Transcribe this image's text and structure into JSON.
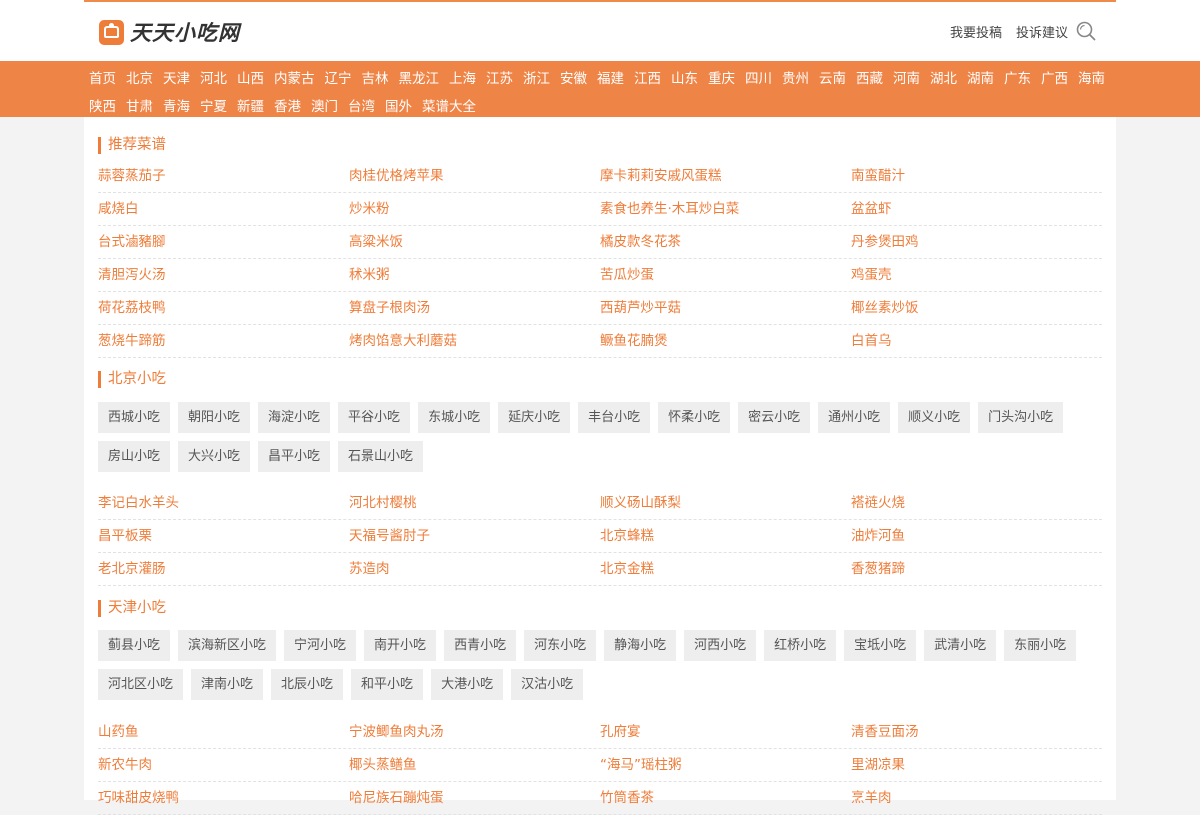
{
  "site": {
    "logo_text": "天天小吃网",
    "header_links": [
      "我要投稿",
      "投诉建议"
    ]
  },
  "nav": [
    "首页",
    "北京",
    "天津",
    "河北",
    "山西",
    "内蒙古",
    "辽宁",
    "吉林",
    "黑龙江",
    "上海",
    "江苏",
    "浙江",
    "安徽",
    "福建",
    "江西",
    "山东",
    "重庆",
    "四川",
    "贵州",
    "云南",
    "西藏",
    "河南",
    "湖北",
    "湖南",
    "广东",
    "广西",
    "海南",
    "陕西",
    "甘肃",
    "青海",
    "宁夏",
    "新疆",
    "香港",
    "澳门",
    "台湾",
    "国外",
    "菜谱大全"
  ],
  "recommended": {
    "title": "推荐菜谱",
    "rows": [
      [
        "蒜蓉蒸茄子",
        "肉桂优格烤苹果",
        "摩卡莉莉安戚风蛋糕",
        "南蛮醋汁"
      ],
      [
        "咸烧白",
        "炒米粉",
        "素食也养生·木耳炒白菜",
        "盆盆虾"
      ],
      [
        "台式滷豬腳",
        "高粱米饭",
        "橘皮款冬花茶",
        "丹参煲田鸡"
      ],
      [
        "清胆泻火汤",
        "秫米粥",
        "苦瓜炒蛋",
        "鸡蛋壳"
      ],
      [
        "荷花荔枝鸭",
        "算盘子根肉汤",
        "西葫芦炒平菇",
        "椰丝素炒饭"
      ],
      [
        "葱烧牛蹄筋",
        "烤肉馅意大利蘑菇",
        "鳜鱼花腩煲",
        "白首乌"
      ]
    ]
  },
  "beijing": {
    "title": "北京小吃",
    "tags": [
      "西城小吃",
      "朝阳小吃",
      "海淀小吃",
      "平谷小吃",
      "东城小吃",
      "延庆小吃",
      "丰台小吃",
      "怀柔小吃",
      "密云小吃",
      "通州小吃",
      "顺义小吃",
      "门头沟小吃",
      "房山小吃",
      "大兴小吃",
      "昌平小吃",
      "石景山小吃"
    ],
    "rows": [
      [
        "李记白水羊头",
        "河北村樱桃",
        "顺义砀山酥梨",
        "褡裢火烧"
      ],
      [
        "昌平板栗",
        "天福号酱肘子",
        "北京蜂糕",
        "油炸河鱼"
      ],
      [
        "老北京灌肠",
        "苏造肉",
        "北京金糕",
        "香葱猪蹄"
      ]
    ]
  },
  "tianjin": {
    "title": "天津小吃",
    "tags": [
      "蓟县小吃",
      "滨海新区小吃",
      "宁河小吃",
      "南开小吃",
      "西青小吃",
      "河东小吃",
      "静海小吃",
      "河西小吃",
      "红桥小吃",
      "宝坻小吃",
      "武清小吃",
      "东丽小吃",
      "河北区小吃",
      "津南小吃",
      "北辰小吃",
      "和平小吃",
      "大港小吃",
      "汉沽小吃"
    ],
    "rows": [
      [
        "山药鱼",
        "宁波鲫鱼肉丸汤",
        "孔府宴",
        "清香豆面汤"
      ],
      [
        "新农牛肉",
        "椰头蒸鳝鱼",
        "“海马”瑶柱粥",
        "里湖凉果"
      ],
      [
        "巧味甜皮烧鸭",
        "哈尼族石蹦炖蛋",
        "竹筒香茶",
        "烹羊肉"
      ]
    ]
  }
}
